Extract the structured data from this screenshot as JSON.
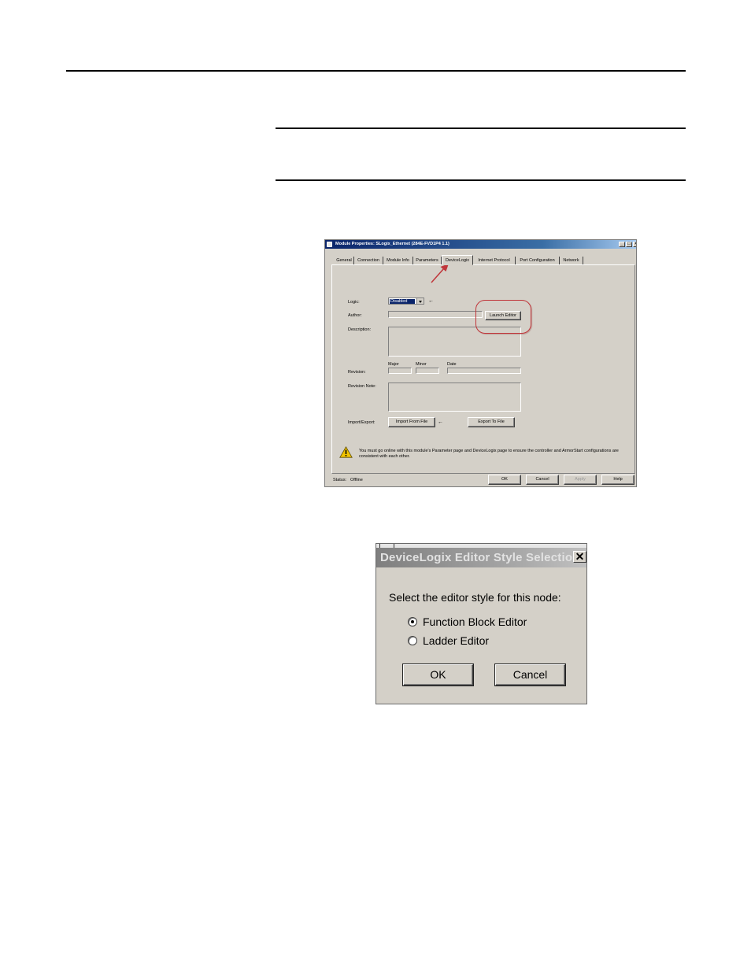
{
  "module_window": {
    "title": "Module Properties: SLogix_Ethernet (284E-FVD1P4 1.1)",
    "tabs": [
      {
        "label": "General"
      },
      {
        "label": "Connection"
      },
      {
        "label": "Module Info"
      },
      {
        "label": "Parameters"
      },
      {
        "label": "DeviceLogix",
        "active": true
      },
      {
        "label": "Internet Protocol"
      },
      {
        "label": "Port Configuration"
      },
      {
        "label": "Network"
      }
    ],
    "logic_label": "Logic:",
    "logic_value": "Disabled",
    "author_label": "Author:",
    "launch_editor_label": "Launch Editor",
    "description_label": "Description:",
    "major_label": "Major",
    "minor_label": "Minor",
    "date_label": "Date",
    "revision_label": "Revision:",
    "revision_note_label": "Revision Note:",
    "import_export_label": "Import/Export:",
    "import_button": "Import From File",
    "export_button": "Export To File",
    "warning_text": "You must go online with this module's Parameter page and DeviceLogix page to ensure the controller and ArmorStart configurations are consistent with each other.",
    "status_label": "Status:",
    "status_value": "Offline",
    "ok_label": "OK",
    "cancel_label": "Cancel",
    "apply_label": "Apply",
    "help_label": "Help",
    "pin_glyph": "←",
    "min_glyph": "_",
    "max_glyph": "□",
    "close_glyph": "×"
  },
  "style_dialog": {
    "title": "DeviceLogix Editor Style Selection",
    "prompt": "Select the editor style for this node:",
    "options": [
      {
        "label": "Function Block Editor",
        "selected": true
      },
      {
        "label": "Ladder Editor",
        "selected": false
      }
    ],
    "ok_label": "OK",
    "cancel_label": "Cancel",
    "close_glyph": "✕"
  },
  "colors": {
    "dialog_face": "#d4d0c8",
    "active_title": "#0a246a",
    "inactive_title": "#a6a6a6",
    "highlight_circle": "#c0353a",
    "arrow": "#c0353a",
    "warning_yellow": "#f2c400"
  },
  "icons": {
    "warning": "warning-triangle-icon",
    "arrow": "red-arrow-icon"
  }
}
